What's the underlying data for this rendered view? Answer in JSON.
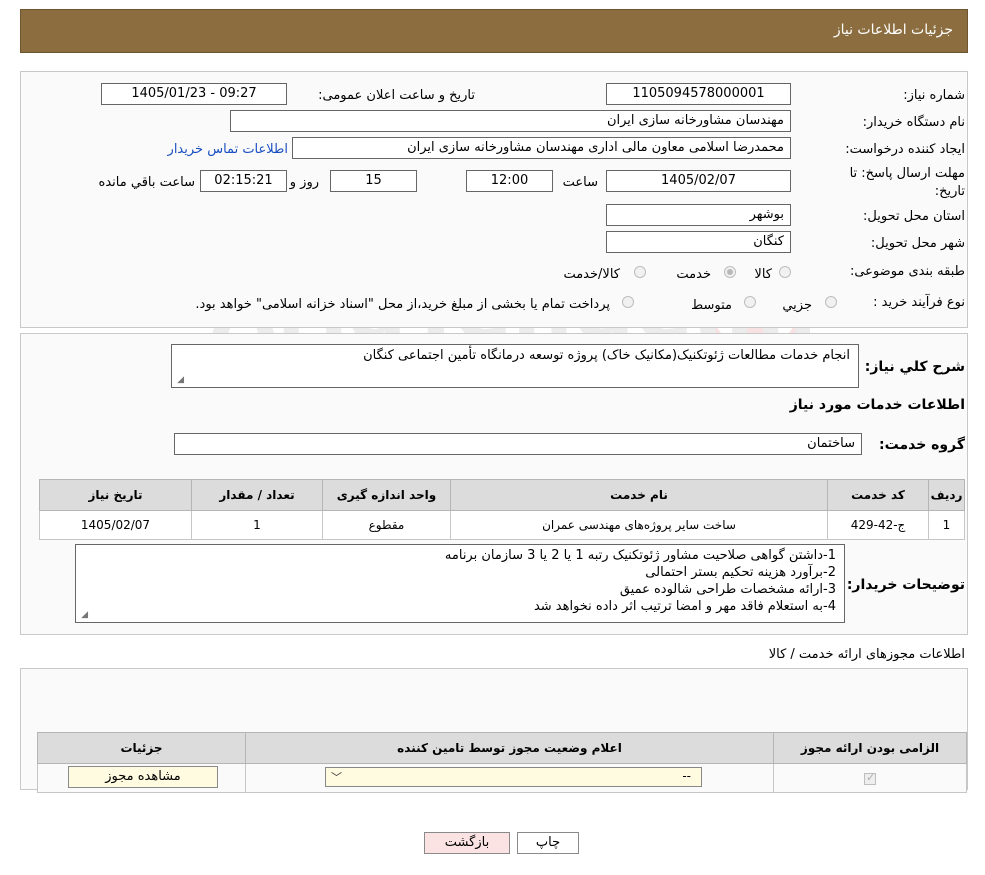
{
  "header": {
    "title": "جزئیات اطلاعات نیاز"
  },
  "info": {
    "need_number_label": "شماره نیاز:",
    "need_number": "1105094578000001",
    "announce_label": "تاریخ و ساعت اعلان عمومی:",
    "announce_value": "1405/01/23 - 09:27",
    "buyer_org_label": "نام دستگاه خریدار:",
    "buyer_org": "مهندسان مشاورخانه سازی ایران",
    "creator_label": "ایجاد کننده درخواست:",
    "creator": "محمدرضا اسلامی معاون مالی اداری مهندسان مشاورخانه سازی ایران",
    "contact_link": "اطلاعات تماس خریدار",
    "deadline_label": "مهلت ارسال پاسخ: تا تاریخ:",
    "deadline_date": "1405/02/07",
    "time_label": "ساعت",
    "deadline_time": "12:00",
    "days_value": "15",
    "days_label": "روز و",
    "remaining_time": "02:15:21",
    "remaining_label": "ساعت باقي مانده",
    "province_label": "استان محل تحویل:",
    "province": "بوشهر",
    "city_label": "شهر محل تحویل:",
    "city": "کنگان",
    "category_label": "طبقه بندی موضوعی:",
    "category_options": [
      "کالا",
      "خدمت",
      "کالا/خدمت"
    ],
    "category_selected": "خدمت",
    "process_label": "نوع فرآیند خرید :",
    "process_options": [
      "جزیي",
      "متوسط"
    ],
    "process_note": "پرداخت تمام یا بخشی از مبلغ خرید،از محل \"اسناد خزانه اسلامی\" خواهد بود."
  },
  "description": {
    "summary_label": "شرح کلي نیاز:",
    "summary": "انجام خدمات مطالعات ژئوتکنیک(مکانیک خاک) پروژه توسعه درمانگاه تأمین اجتماعی کنگان",
    "services_heading": "اطلاعات خدمات مورد نیاز",
    "service_group_label": "گروه خدمت:",
    "service_group": "ساختمان",
    "table": {
      "headers": [
        "ردیف",
        "کد خدمت",
        "نام خدمت",
        "واحد اندازه گیری",
        "تعداد / مقدار",
        "تاریخ نیاز"
      ],
      "rows": [
        [
          "1",
          "ج-42-429",
          "ساخت سایر پروژه‌های مهندسی عمران",
          "مقطوع",
          "1",
          "1405/02/07"
        ]
      ]
    },
    "buyer_notes_label": "توضیحات خریدار:",
    "buyer_notes": [
      "1-داشتن گواهی صلاحیت مشاور ژئوتکنیک رتبه 1 یا 2 یا 3 سازمان برنامه",
      "2-برآورد هزینه تحکیم بستر احتمالی",
      "3-ارائه مشخصات طراحی شالوده عمیق",
      "4-به استعلام فاقد مهر و امضا ترتیب اثر داده نخواهد شد"
    ]
  },
  "licenses": {
    "heading": "اطلاعات مجوزهای ارائه خدمت / کالا",
    "headers": [
      "الزامی بودن ارائه مجوز",
      "اعلام وضعیت مجوز توسط تامین کننده",
      "جزئیات"
    ],
    "select_value": "--",
    "view_button": "مشاهده مجوز"
  },
  "actions": {
    "print_label": "چاپ",
    "back_label": "بازگشت"
  },
  "colors": {
    "title_bar": "#8b6d3f",
    "back_button_bg": "#fbe3e3",
    "link": "#1a4fc2"
  }
}
